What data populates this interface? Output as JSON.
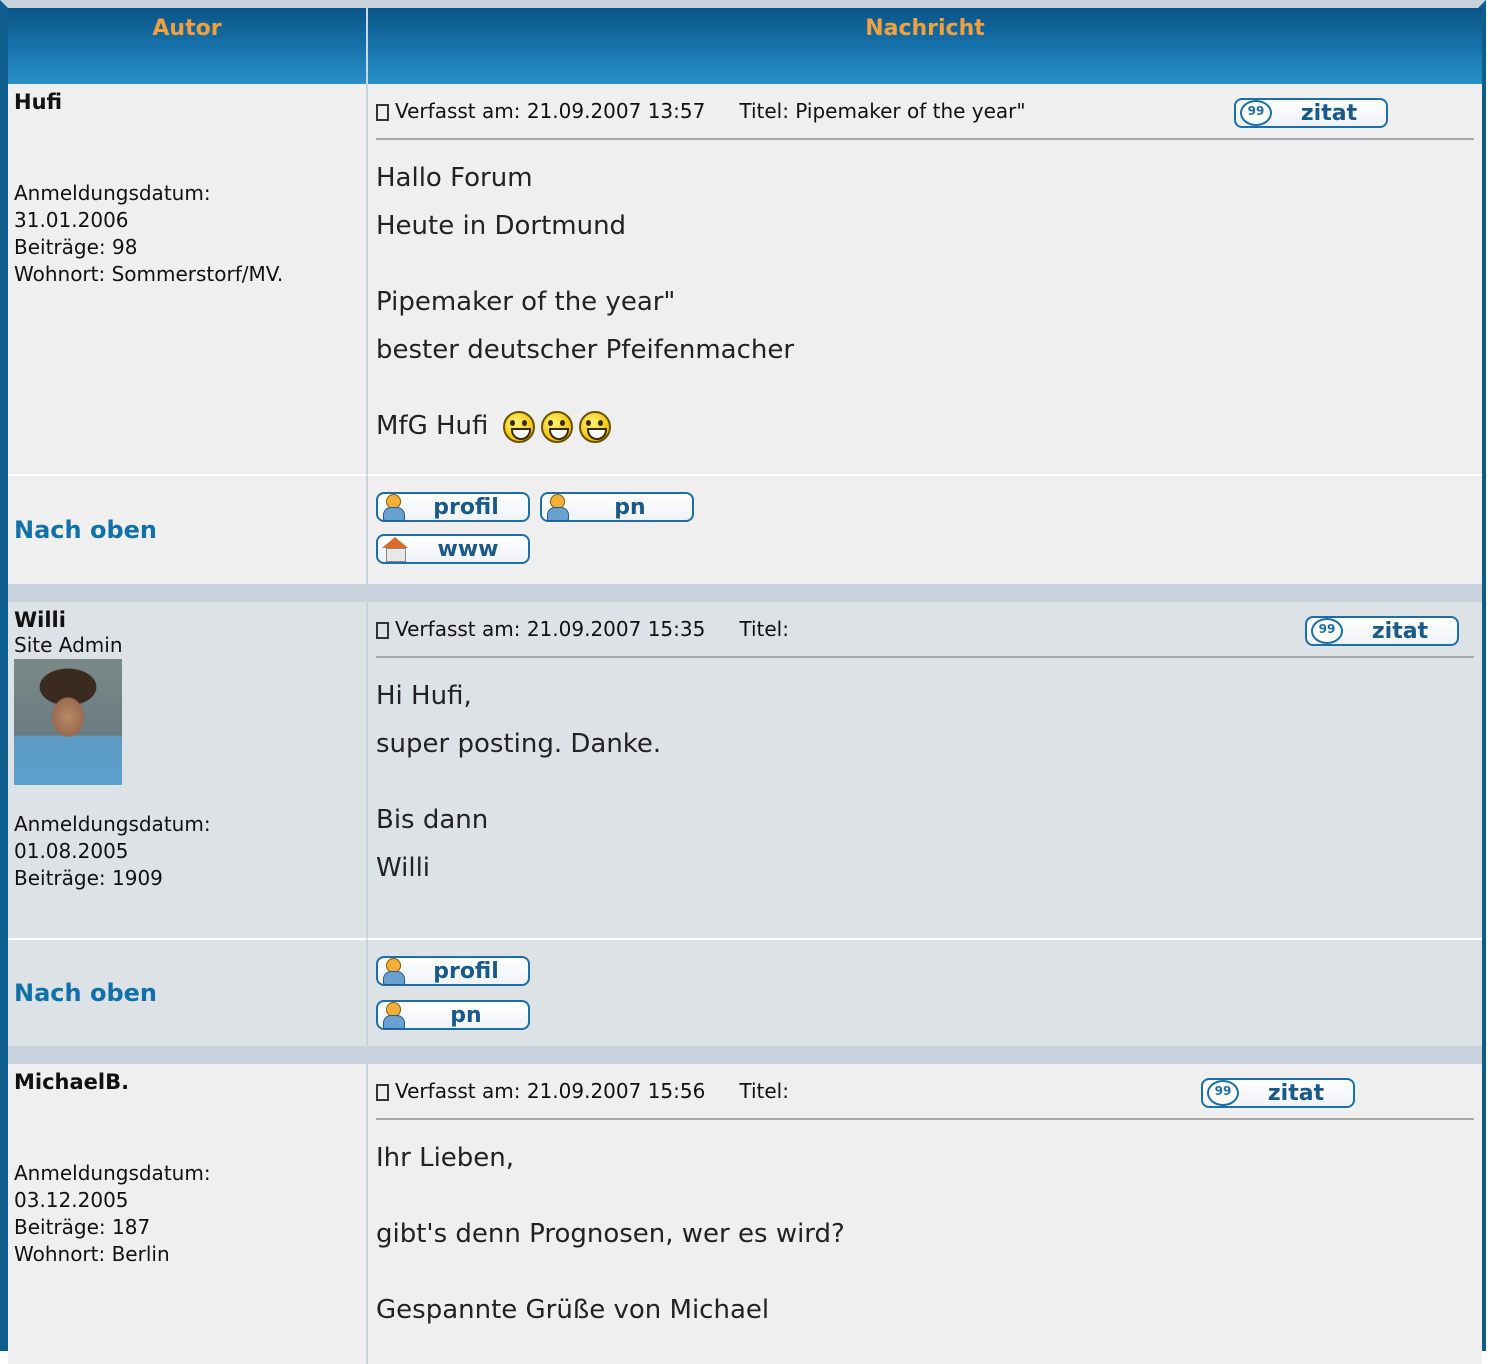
{
  "header": {
    "author": "Autor",
    "message": "Nachricht"
  },
  "posts": [
    {
      "author": "Hufi",
      "rank": "",
      "info": [
        "Anmeldungsdatum:",
        "31.01.2006",
        "Beiträge: 98",
        "Wohnort: Sommerstorf/MV."
      ],
      "posted": "Verfasst am: 21.09.2007 13:57",
      "title": "Titel: Pipemaker of the year\"",
      "body": [
        "Hallo Forum",
        "Heute in Dortmund",
        "",
        "Pipemaker of the year\"",
        "bester deutscher Pfeifenmacher",
        "",
        "MfG Hufi"
      ],
      "smileys": 3,
      "quote_label": "zitat",
      "nav_label": "Nach oben",
      "buttons": [
        "profil",
        "pn",
        "www"
      ]
    },
    {
      "author": "Willi",
      "rank": "Site Admin",
      "info": [
        "Anmeldungsdatum:",
        "01.08.2005",
        "Beiträge: 1909"
      ],
      "posted": "Verfasst am: 21.09.2007 15:35",
      "title": "Titel:",
      "body": [
        "Hi Hufi,",
        "super posting. Danke.",
        "",
        "Bis dann",
        "Willi"
      ],
      "quote_label": "zitat",
      "nav_label": "Nach oben",
      "buttons": [
        "profil",
        "pn"
      ]
    },
    {
      "author": "MichaelB.",
      "rank": "",
      "info": [
        "Anmeldungsdatum:",
        "03.12.2005",
        "Beiträge: 187",
        "Wohnort: Berlin"
      ],
      "posted": "Verfasst am: 21.09.2007 15:56",
      "title": "Titel:",
      "body": [
        "Ihr Lieben,",
        "",
        "gibt's denn Prognosen, wer es wird?",
        "",
        "Gespannte Grüße von Michael"
      ],
      "quote_label": "zitat"
    }
  ],
  "colors": {
    "header_text": "#f0a040",
    "link": "#1270a8",
    "frame": "#0f5d8c"
  }
}
